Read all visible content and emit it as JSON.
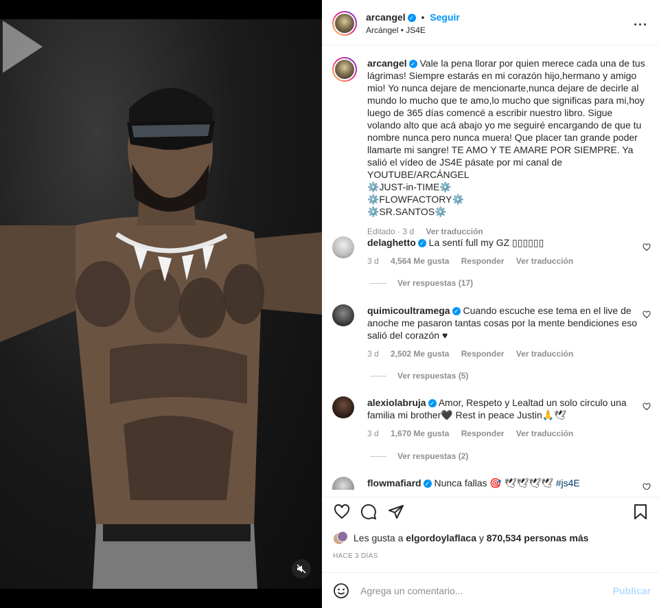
{
  "post": {
    "media": {
      "play_icon": "play-icon",
      "mute_icon": "muted-speaker-icon"
    },
    "author": {
      "username": "arcangel",
      "verified_icon": "verified-badge-icon",
      "follow_label": "Seguir",
      "separator": "•",
      "subtitle": "Arcángel • JS4E"
    },
    "more_icon": "more-options-icon",
    "caption": {
      "username": "arcangel",
      "text": "Vale la pena llorar por quien merece cada una de tus lágrimas! Siempre estarás en mi corazón hijo,hermano y amigo mio! Yo nunca dejare de mencionarte,nunca dejare de decirle al mundo lo mucho que te amo,lo mucho que significas para mi,hoy luego de 365 días comencé a escribir nuestro libro. Sigue volando alto que acá abajo yo me seguiré encargando de que tu nombre nunca pero nunca muera! Que placer tan grande poder llamarte mi sangre! TE AMO Y TE AMARE POR SIEMPRE. Ya salió el vídeo de JS4E pásate por mi canal de YOUTUBE/ARCÁNGEL",
      "line1": "⚙️JUST-in-TIME⚙️",
      "line2": "⚙️FLOWFACTORY⚙️",
      "line3": "⚙️SR.SANTOS⚙️",
      "edited": "Editado · 3 d",
      "translate": "Ver traducción"
    },
    "comments": [
      {
        "username": "delaghetto",
        "text": "La sentí full my GZ ▯▯▯▯▯▯",
        "time": "3 d",
        "likes": "4,564 Me gusta",
        "reply": "Responder",
        "translate": "Ver traducción",
        "replies": "Ver respuestas (17)"
      },
      {
        "username": "quimicoultramega",
        "text": "Cuando escuche ese tema en el live de anoche me pasaron tantas cosas por la mente bendiciones eso salió del corazón ♥",
        "time": "3 d",
        "likes": "2,502 Me gusta",
        "reply": "Responder",
        "translate": "Ver traducción",
        "replies": "Ver respuestas (5)"
      },
      {
        "username": "alexiolabruja",
        "text": "Amor, Respeto y Lealtad un solo circulo una familia mi brother🖤 Rest in peace Justin🙏🕊",
        "time": "3 d",
        "likes": "1,670 Me gusta",
        "reply": "Responder",
        "translate": "Ver traducción",
        "replies": "Ver respuestas (2)"
      },
      {
        "username": "flowmafiard",
        "text": "Nunca fallas 🎯 🕊🕊🕊🕊",
        "hashtag": "#js4E"
      }
    ],
    "likes_text_prefix": "Les gusta a",
    "likes_user": "elgordoylaflaca",
    "likes_joiner": "y",
    "likes_count": "870,534 personas más",
    "time_ago": "HACE 3 DÍAS",
    "comment_placeholder": "Agrega un comentario...",
    "publish_label": "Publicar"
  }
}
